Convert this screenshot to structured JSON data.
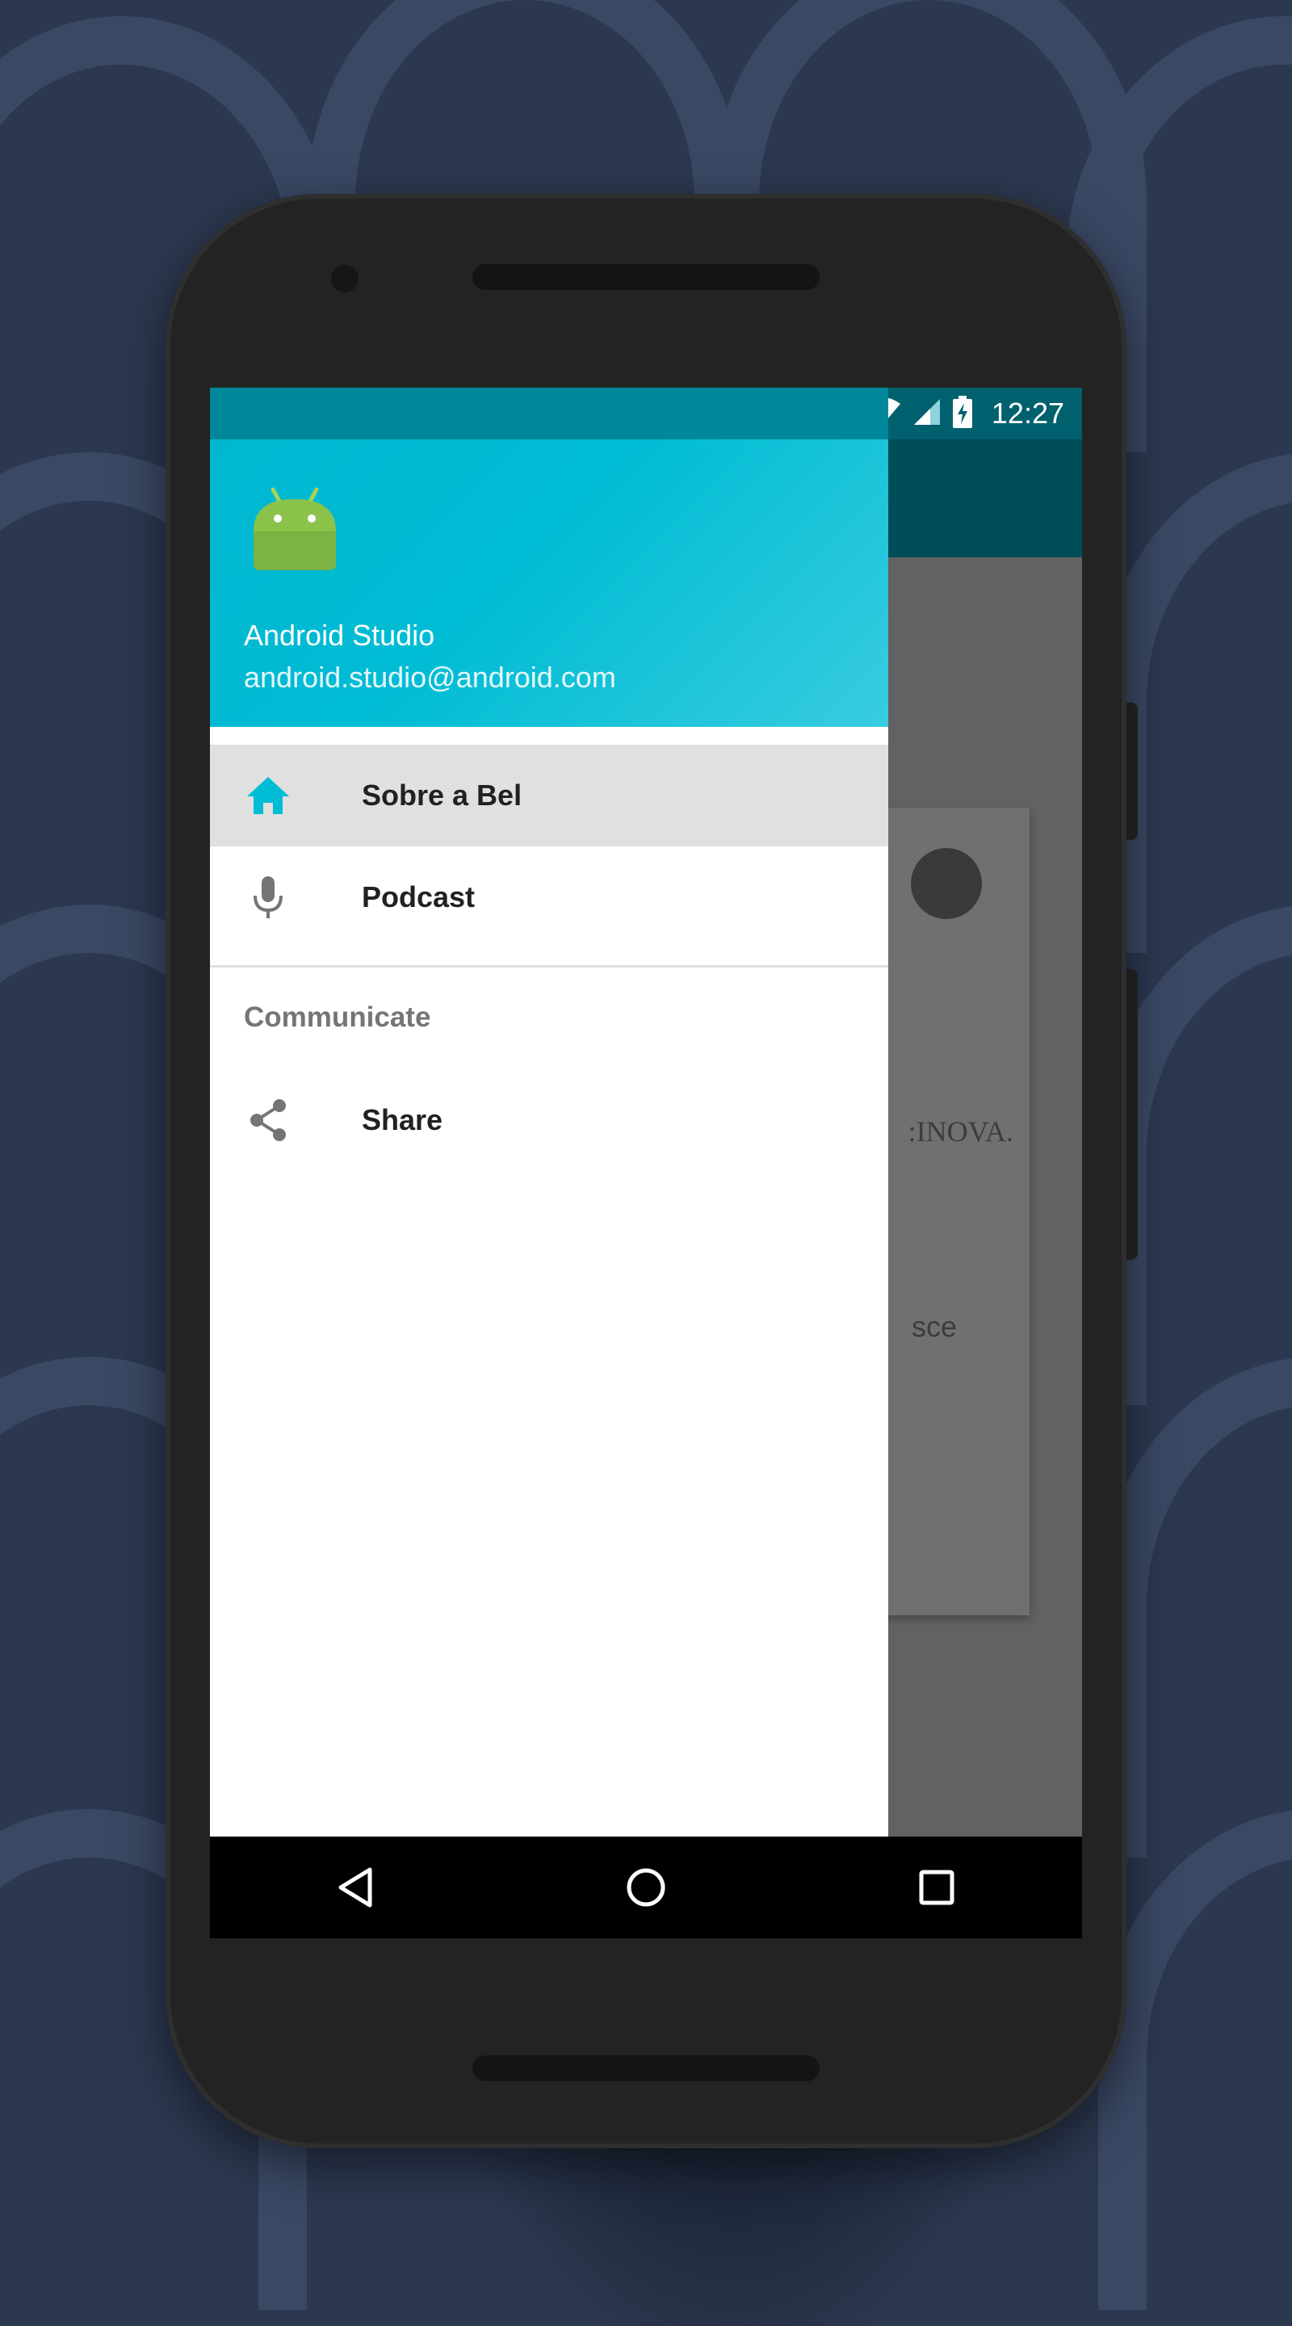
{
  "status_bar": {
    "time": "12:27",
    "icons": [
      "wifi-icon",
      "signal-icon",
      "battery-charging-icon"
    ]
  },
  "drawer": {
    "header": {
      "name": "Android Studio",
      "email": "android.studio@android.com",
      "logo_icon": "android-logo-icon"
    },
    "items": [
      {
        "label": "Sobre a Bel",
        "icon": "home-icon",
        "selected": true
      },
      {
        "label": "Podcast",
        "icon": "microphone-icon",
        "selected": false
      }
    ],
    "section": {
      "title": "Communicate",
      "items": [
        {
          "label": "Share",
          "icon": "share-icon"
        }
      ]
    }
  },
  "background_content": {
    "text_line_1": ":INOVA.",
    "text_line_2": "sce"
  },
  "navigation_bar": {
    "buttons": [
      "back-icon",
      "home-circle-icon",
      "recents-icon"
    ]
  },
  "colors": {
    "accent": "#00bcd4",
    "primary_dark": "#004d5a",
    "selected_item_bg": "#e0e0e0"
  }
}
